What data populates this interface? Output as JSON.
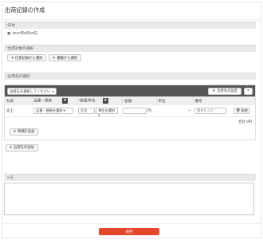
{
  "page": {
    "title": "出荷記録の作成"
  },
  "date_section": {
    "header": "日付",
    "value": "2017年9月20日"
  },
  "target_section": {
    "header": "出荷対象の選択",
    "buttons": [
      "仕掛記録から選択",
      "書籍から選択"
    ]
  },
  "dest_section": {
    "header": "出荷先の選択",
    "dest_placeholder": "出荷先を選択してください",
    "settings_label": "出荷先の設定",
    "close": "×",
    "columns": [
      "科目",
      "品番・規格",
      "*数量/単位",
      "*金額",
      "単位",
      "備考"
    ],
    "row": {
      "subject": "売上",
      "product_placeholder": "品番・規格を選択",
      "qty_placeholder": "数量",
      "unit_placeholder": "単位を選択",
      "price_unit": "円",
      "unit_dash": "---",
      "note_placeholder": "備考を入力",
      "delete_label": "削除"
    },
    "total_label": "合計",
    "total_value": "0円",
    "add_item_label": "明細を追加",
    "add_dest_label": "出荷先の追加"
  },
  "memo_section": {
    "header": "メモ"
  },
  "save_label": "保存"
}
